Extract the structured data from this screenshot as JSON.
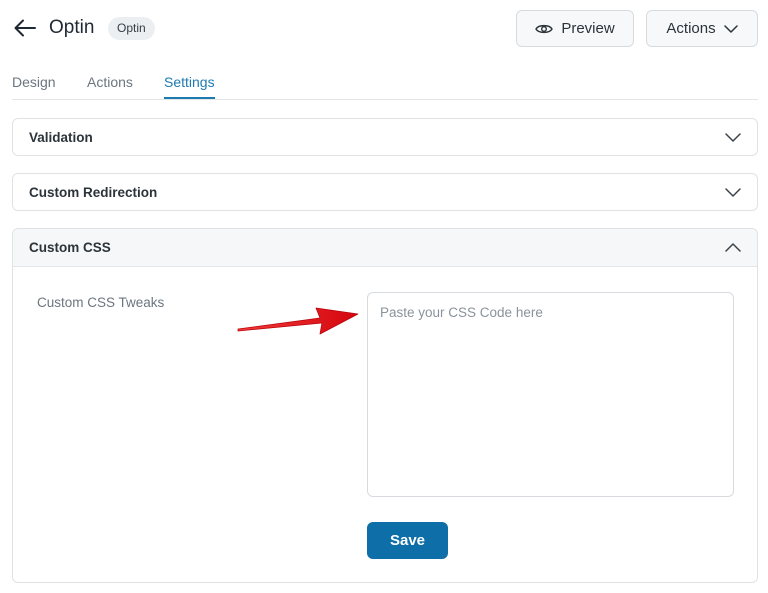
{
  "header": {
    "title": "Optin",
    "badge": "Optin",
    "preview_label": "Preview",
    "actions_label": "Actions"
  },
  "tabs": [
    {
      "label": "Design",
      "active": false
    },
    {
      "label": "Actions",
      "active": false
    },
    {
      "label": "Settings",
      "active": true
    }
  ],
  "panels": {
    "validation": {
      "title": "Validation",
      "expanded": false
    },
    "redirection": {
      "title": "Custom Redirection",
      "expanded": false
    },
    "custom_css": {
      "title": "Custom CSS",
      "expanded": true,
      "field_label": "Custom CSS Tweaks",
      "placeholder": "Paste your CSS Code here",
      "value": "",
      "save_label": "Save"
    }
  },
  "colors": {
    "accent": "#1d7bb0",
    "save_button": "#0d6ea8",
    "annotation_arrow": "#e8141c"
  },
  "icons": {
    "back": "arrow-left-icon",
    "preview": "eye-icon",
    "dropdown": "chevron-down-icon",
    "collapse": "chevron-up-icon"
  }
}
